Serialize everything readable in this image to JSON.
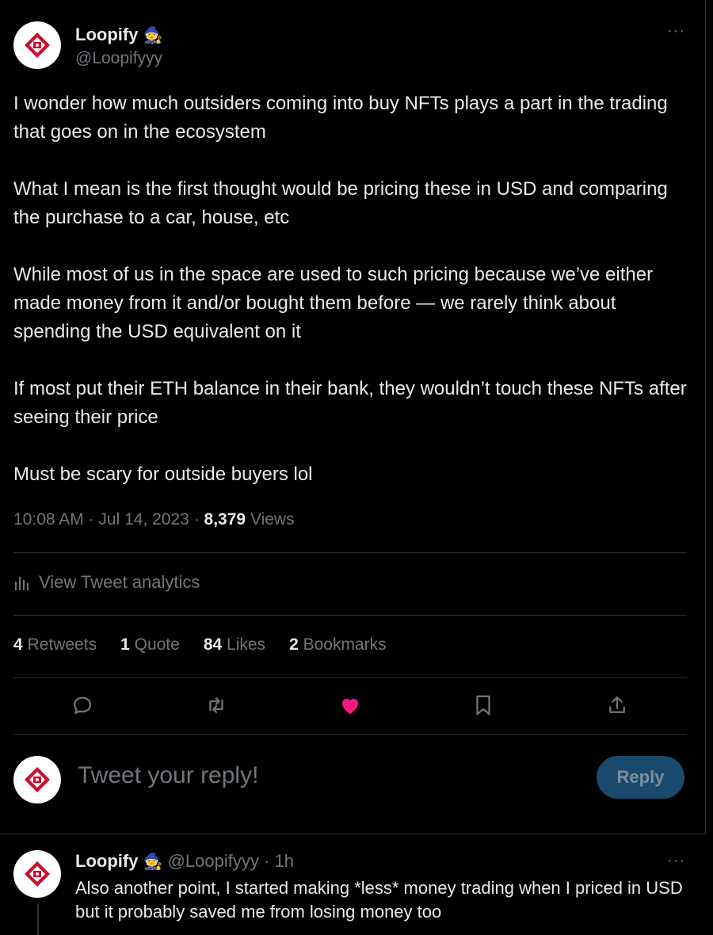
{
  "tweet": {
    "author_name": "Loopify",
    "author_emoji": "🧙",
    "author_handle": "@Loopifyyy",
    "more": "···",
    "paragraphs": [
      "I wonder how much outsiders coming into buy NFTs plays a part in the trading that goes on in the ecosystem",
      "What I mean is the first thought would be pricing these in USD and comparing the purchase to a car, house, etc",
      "While most of us in the space are used to such pricing because we’ve either made money from it and/or bought them before — we rarely think about spending the USD equivalent on it",
      "If most put their ETH balance in their bank, they wouldn’t touch these NFTs after seeing their price",
      "Must be scary for outside buyers lol"
    ],
    "time": "10:08 AM",
    "date": "Jul 14, 2023",
    "views_count": "8,379",
    "views_label": "Views",
    "analytics_label": "View Tweet analytics",
    "stats": {
      "retweets_count": "4",
      "retweets_label": "Retweets",
      "quotes_count": "1",
      "quotes_label": "Quote",
      "likes_count": "84",
      "likes_label": "Likes",
      "bookmarks_count": "2",
      "bookmarks_label": "Bookmarks"
    }
  },
  "reply_box": {
    "placeholder": "Tweet your reply!",
    "button_label": "Reply"
  },
  "reply_tweet": {
    "author_name": "Loopify",
    "author_emoji": "🧙",
    "author_handle": "@Loopifyyy",
    "time_ago": "1h",
    "more": "···",
    "text": "Also another point, I started making *less* money trading when I priced in USD but it probably saved me from losing money too"
  },
  "colors": {
    "like_active": "#f91880",
    "accent": "#1d9bf0"
  }
}
